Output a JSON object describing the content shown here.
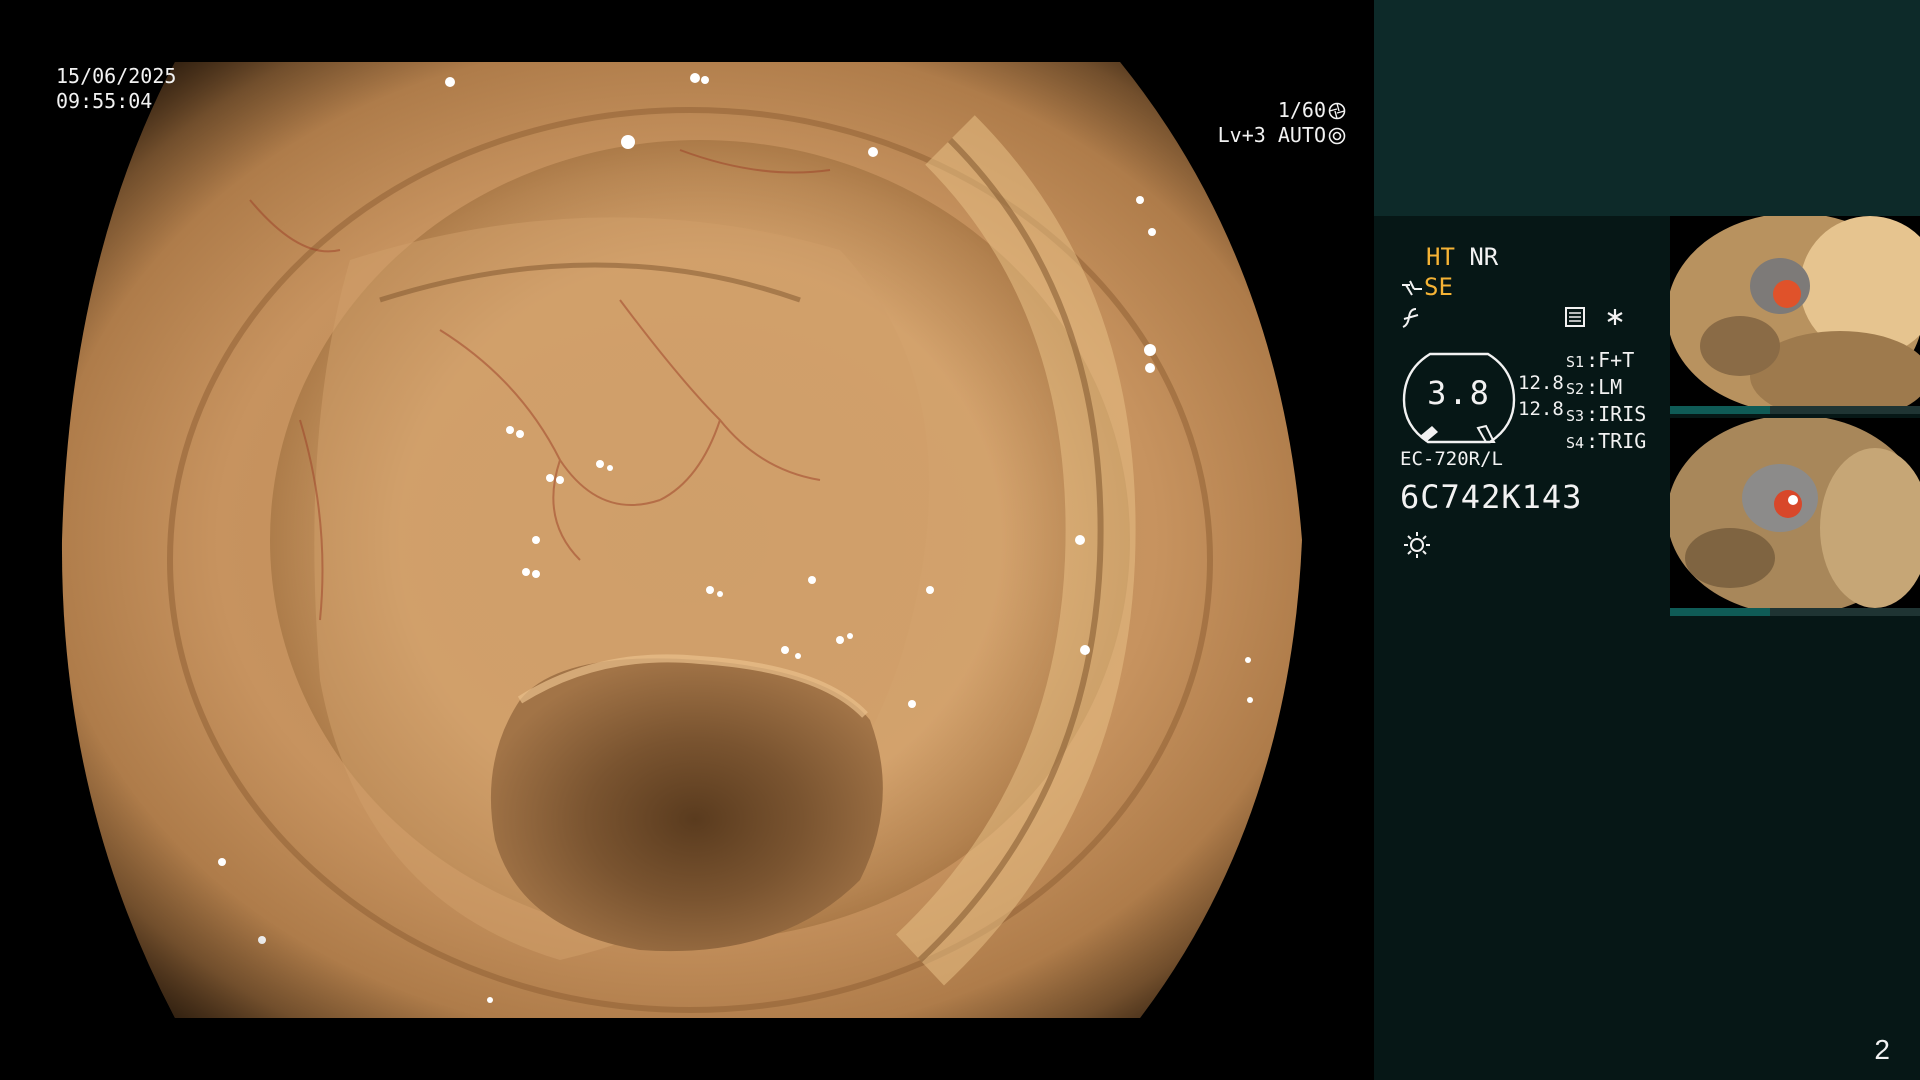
{
  "overlay": {
    "date": "15/06/2025",
    "time": "09:55:04",
    "shutter": "1/60",
    "level": "Lv+3",
    "iris_mode": "AUTO"
  },
  "status": {
    "ht": "HT",
    "nr": "NR",
    "se": "SE"
  },
  "gauge": {
    "value": "3.8",
    "side_top": "12.8",
    "side_bottom": "12.8"
  },
  "switches": [
    {
      "key": "S1",
      "label": "F+T"
    },
    {
      "key": "S2",
      "label": "LM"
    },
    {
      "key": "S3",
      "label": "IRIS"
    },
    {
      "key": "S4",
      "label": "TRIG"
    }
  ],
  "scope": {
    "model": "EC-720R/L",
    "serial": "6C742K143"
  },
  "thumbnails": [
    {
      "id": "thumb-1",
      "bar_fill": 0.4
    },
    {
      "id": "thumb-2",
      "bar_fill": 0.4
    }
  ],
  "icons": [
    "aperture-icon",
    "iris-icon",
    "enhance-icon",
    "filter-icon",
    "memo-icon",
    "asterisk-icon",
    "light-icon"
  ],
  "colors": {
    "accent_amber": "#f5b335",
    "panel_bg": "#061716",
    "header_bg": "#0d2a29",
    "osd_text": "#f2f2f2"
  },
  "page": {
    "number": "2"
  }
}
